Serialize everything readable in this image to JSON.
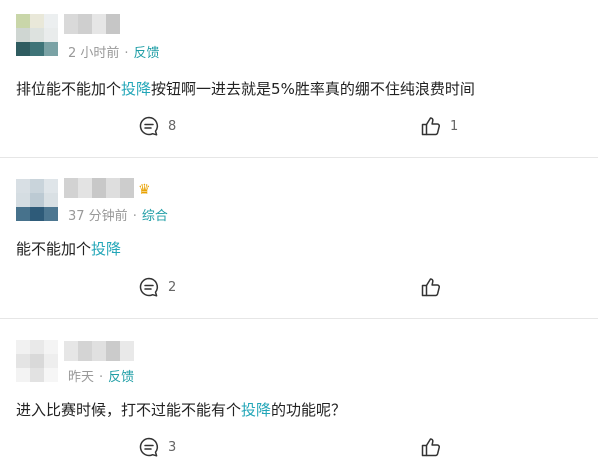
{
  "colors": {
    "accent": "#23a6b8",
    "meta": "#999999",
    "divider": "#e6e6e6"
  },
  "posts": [
    {
      "meta_time": "2 小时前",
      "meta_dot": "·",
      "meta_tag": "反馈",
      "text_before": "排位能不能加个",
      "text_highlight": "投降",
      "text_after": "按钮啊一进去就是5%胜率真的绷不住纯浪费时间",
      "comments": "8",
      "likes": "1",
      "comment_icon": "comment-bubble-icon",
      "like_icon": "thumbs-up-icon"
    },
    {
      "meta_time": "37 分钟前",
      "meta_dot": "·",
      "meta_tag": "综合",
      "text_before": "能不能加个",
      "text_highlight": "投降",
      "text_after": "",
      "comments": "2",
      "likes": "",
      "comment_icon": "comment-bubble-icon",
      "like_icon": "thumbs-up-icon"
    },
    {
      "meta_time": "昨天",
      "meta_dot": "·",
      "meta_tag": "反馈",
      "text_before": "进入比赛时候，打不过能不能有个",
      "text_highlight": "投降",
      "text_after": "的功能呢？",
      "comments": "3",
      "likes": "",
      "comment_icon": "comment-bubble-icon",
      "like_icon": "thumbs-up-icon"
    }
  ]
}
